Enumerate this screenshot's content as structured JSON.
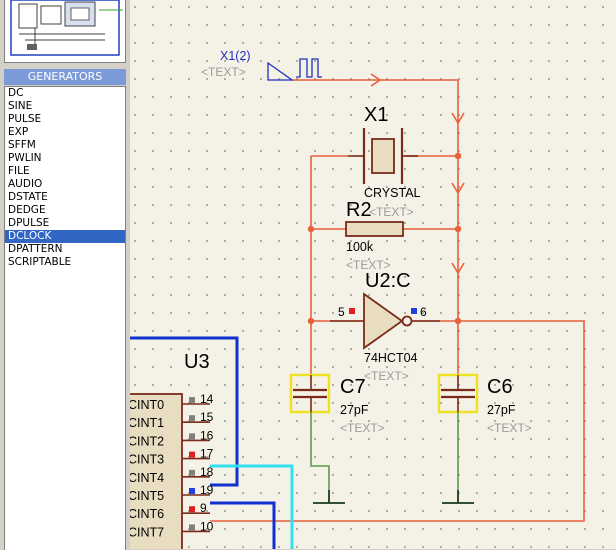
{
  "sidebar": {
    "generators_header": "GENERATORS",
    "items": [
      "DC",
      "SINE",
      "PULSE",
      "EXP",
      "SFFM",
      "PWLIN",
      "FILE",
      "AUDIO",
      "DSTATE",
      "DEDGE",
      "DPULSE",
      "DCLOCK",
      "DPATTERN",
      "SCRIPTABLE"
    ],
    "selected_index": 11
  },
  "schematic": {
    "generator": {
      "name": "X1(2)",
      "text": "<TEXT>"
    },
    "crystal": {
      "ref": "X1",
      "value": "CRYSTAL",
      "text": "<TEXT>"
    },
    "resistor": {
      "ref": "R2",
      "value": "100k",
      "text": "<TEXT>"
    },
    "inverter": {
      "ref": "U2:C",
      "value": "74HCT04",
      "text": "<TEXT>",
      "pin_in": "5",
      "pin_out": "6"
    },
    "cap_c7": {
      "ref": "C7",
      "value": "27pF",
      "text": "<TEXT>"
    },
    "cap_c6": {
      "ref": "C6",
      "value": "27pF",
      "text": "<TEXT>"
    },
    "u3": {
      "ref": "U3",
      "pins": [
        {
          "name": "CINT0",
          "num": "14"
        },
        {
          "name": "CINT1",
          "num": "15"
        },
        {
          "name": "CINT2",
          "num": "16"
        },
        {
          "name": "CINT3",
          "num": "17"
        },
        {
          "name": "CINT4",
          "num": "18"
        },
        {
          "name": "CINT5",
          "num": "19"
        },
        {
          "name": "CINT6",
          "num": "9"
        },
        {
          "name": "CINT7",
          "num": "10"
        }
      ]
    }
  },
  "colors": {
    "wire": "#e8603c",
    "component": "#7a2a1a",
    "ground_wire": "#5a9a4a",
    "bus_blue": "#1030d0",
    "bus_cyan": "#30e0f0",
    "cap_highlight": "#f0e020",
    "pin_red": "#e02020",
    "pin_blue": "#2040e0",
    "pin_gray": "#808080",
    "label_gray": "#9a9a9a",
    "generator_blue": "#2030c0"
  }
}
